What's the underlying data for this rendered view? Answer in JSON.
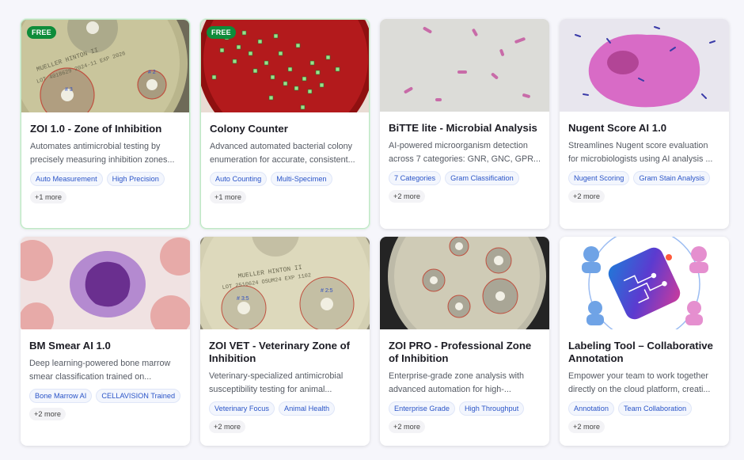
{
  "cards": [
    {
      "badge": "FREE",
      "title": "ZOI 1.0 - Zone of Inhibition",
      "desc": "Automates antimicrobial testing by precisely measuring inhibition zones...",
      "tags": [
        "Auto Measurement",
        "High Precision"
      ],
      "more": "+1 more",
      "image": "agar-plate-zones",
      "plate_text_1": "MUELLER HINTON II",
      "plate_text_2": "LOT 4018629 2024-11 EXP 2026",
      "zone_label_1": "# 3",
      "zone_label_2": "# 2"
    },
    {
      "badge": "FREE",
      "title": "Colony Counter",
      "desc": "Advanced automated bacterial colony enumeration for accurate, consistent...",
      "tags": [
        "Auto Counting",
        "Multi-Specimen"
      ],
      "more": "+1 more",
      "image": "red-agar-colonies"
    },
    {
      "title": "BiTTE lite - Microbial Analysis",
      "desc": "AI-powered microorganism detection across 7 categories: GNR, GNC, GPR...",
      "tags": [
        "7 Categories",
        "Gram Classification"
      ],
      "more": "+2 more",
      "image": "gram-stain-rods"
    },
    {
      "title": "Nugent Score AI 1.0",
      "desc": "Streamlines Nugent score evaluation for microbiologists using AI analysis ...",
      "tags": [
        "Nugent Scoring",
        "Gram Stain Analysis"
      ],
      "more": "+2 more",
      "image": "epithelial-cell-stain"
    },
    {
      "title": "BM Smear AI 1.0",
      "desc": "Deep learning-powered bone marrow smear classification trained on...",
      "tags": [
        "Bone Marrow AI",
        "CELLAVISION Trained"
      ],
      "more": "+2 more",
      "image": "bone-marrow-cell"
    },
    {
      "title": "ZOI VET - Veterinary Zone of Inhibition",
      "desc": "Veterinary-specialized antimicrobial susceptibility testing for animal...",
      "tags": [
        "Veterinary Focus",
        "Animal Health"
      ],
      "more": "+2 more",
      "image": "agar-plate-vet",
      "plate_text_1": "MUELLER HINTON II",
      "plate_text_2": "LOT 2510624 OSUM24 EXP 1102",
      "zone_label_1": "# 3:5",
      "zone_label_2": "# 2:5"
    },
    {
      "title": "ZOI PRO - Professional Zone of Inhibition",
      "desc": "Enterprise-grade zone analysis with advanced automation for high-...",
      "tags": [
        "Enterprise Grade",
        "High Throughput"
      ],
      "more": "+2 more",
      "image": "agar-plate-pro"
    },
    {
      "title": "Labeling Tool – Collaborative Annotation",
      "desc": "Empower your team to work together directly on the cloud platform, creati...",
      "tags": [
        "Annotation",
        "Team Collaboration"
      ],
      "more": "+2 more",
      "image": "ai-chip-collaboration"
    }
  ],
  "colors": {
    "badge": "#0e8c3a",
    "tag_text": "#2b55c8",
    "featured_border": "#bfe6c6"
  }
}
